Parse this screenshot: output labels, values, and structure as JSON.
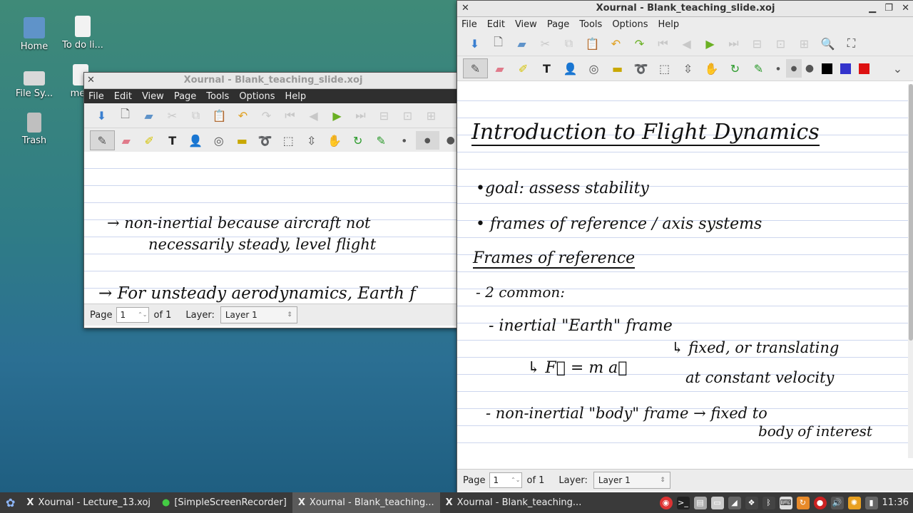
{
  "desktop": {
    "icons": [
      {
        "label": "Home"
      },
      {
        "label": "To do li..."
      },
      {
        "label": "File Sy..."
      },
      {
        "label": "mea"
      },
      {
        "label": "Trash"
      }
    ]
  },
  "back_window": {
    "title": "Xournal - Blank_teaching_slide.xoj",
    "menu": [
      "File",
      "Edit",
      "View",
      "Page",
      "Tools",
      "Options",
      "Help"
    ],
    "lines": [
      "→ non-inertial because aircraft not",
      "necessarily steady, level flight",
      "→ For unsteady aerodynamics, Earth f"
    ],
    "status": {
      "page_label": "Page",
      "page_value": "1",
      "of_label": "of 1",
      "layer_label": "Layer:",
      "layer_value": "Layer 1"
    }
  },
  "main_window": {
    "title": "Xournal - Blank_teaching_slide.xoj",
    "menu": [
      "File",
      "Edit",
      "View",
      "Page",
      "Tools",
      "Options",
      "Help"
    ],
    "colors": {
      "black": "#000000",
      "blue": "#3333cc",
      "red": "#dd1111"
    },
    "notes": {
      "title": "Introduction to Flight Dynamics",
      "bullet1": "•goal: assess stability",
      "bullet2": "• frames of reference / axis systems",
      "heading": "Frames of reference",
      "common": "- 2 common:",
      "inertial": "- inertial \"Earth\" frame",
      "fixed": "↳ fixed, or translating",
      "velocity": "at constant velocity",
      "newton": "↳ F⃗ = m a⃗",
      "noninertial": "- non-inertial \"body\" frame → fixed to",
      "interest": "body of interest"
    },
    "status": {
      "page_label": "Page",
      "page_value": "1",
      "of_label": "of 1",
      "layer_label": "Layer:",
      "layer_value": "Layer 1"
    }
  },
  "taskbar": {
    "tasks": [
      {
        "label": "Xournal - Lecture_13.xoj",
        "icon": "X"
      },
      {
        "label": "[SimpleScreenRecorder]",
        "icon": "●"
      },
      {
        "label": "Xournal - Blank_teaching...",
        "icon": "X"
      },
      {
        "label": "Xournal - Blank_teaching...",
        "icon": "X"
      }
    ],
    "clock": "11:36"
  }
}
